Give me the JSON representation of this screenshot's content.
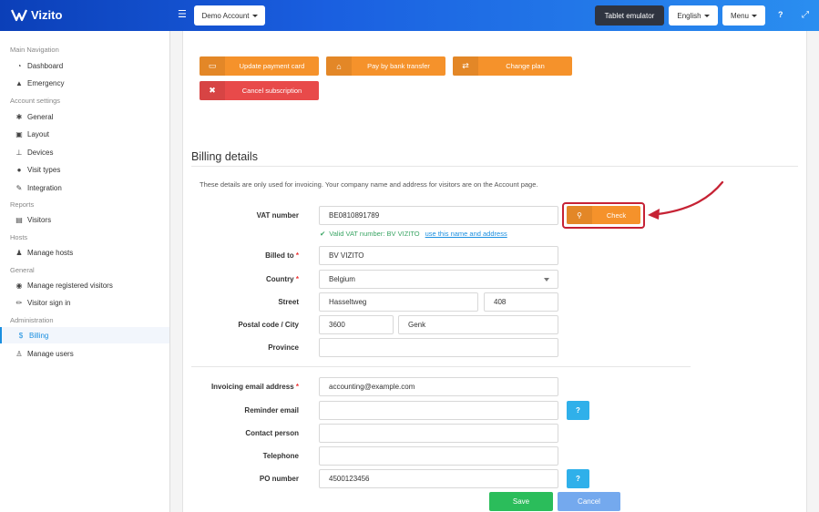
{
  "topbar": {
    "brand": "Vizito",
    "account_label": "Demo Account",
    "tablet_label": "Tablet emulator",
    "language_label": "English",
    "menu_label": "Menu",
    "help_label": "?"
  },
  "sidebar": {
    "sections": [
      {
        "title": "Main Navigation",
        "items": [
          {
            "label": "Dashboard",
            "icon": "dashboard-icon"
          },
          {
            "label": "Emergency",
            "icon": "warning-icon"
          }
        ]
      },
      {
        "title": "Account settings",
        "items": [
          {
            "label": "General",
            "icon": "gear-icon"
          },
          {
            "label": "Layout",
            "icon": "image-icon"
          },
          {
            "label": "Devices",
            "icon": "sitemap-icon"
          },
          {
            "label": "Visit types",
            "icon": "users-icon"
          },
          {
            "label": "Integration",
            "icon": "plug-icon"
          }
        ]
      },
      {
        "title": "Reports",
        "items": [
          {
            "label": "Visitors",
            "icon": "book-icon"
          }
        ]
      },
      {
        "title": "Hosts",
        "items": [
          {
            "label": "Manage hosts",
            "icon": "person-icon"
          }
        ]
      },
      {
        "title": "General",
        "items": [
          {
            "label": "Manage registered visitors",
            "icon": "globe-icon"
          },
          {
            "label": "Visitor sign in",
            "icon": "pencil-icon"
          }
        ]
      },
      {
        "title": "Administration",
        "items": [
          {
            "label": "Billing",
            "icon": "dollar-icon",
            "active": true
          },
          {
            "label": "Manage users",
            "icon": "user-plus-icon"
          }
        ]
      }
    ]
  },
  "actions": {
    "update_card": "Update payment card",
    "bank_transfer": "Pay by bank transfer",
    "change_plan": "Change plan",
    "cancel_subscription": "Cancel subscription"
  },
  "billing": {
    "title": "Billing details",
    "description": "These details are only used for invoicing. Your company name and address for visitors are on the Account page.",
    "vat_label": "VAT number",
    "vat_value": "BE0810891789",
    "check_label": "Check",
    "valid_text": "Valid VAT number: BV VIZITO",
    "use_link": "use this name and address",
    "billed_to_label": "Billed to",
    "billed_to_value": "BV VIZITO",
    "country_label": "Country",
    "country_value": "Belgium",
    "street_label": "Street",
    "street_value": "Hasseltweg",
    "number_value": "408",
    "postal_label": "Postal code / City",
    "postal_value": "3600",
    "city_value": "Genk",
    "province_label": "Province",
    "province_value": "",
    "invoice_email_label": "Invoicing email address",
    "invoice_email_value": "accounting@example.com",
    "reminder_label": "Reminder email",
    "reminder_value": "",
    "contact_label": "Contact person",
    "contact_value": "",
    "telephone_label": "Telephone",
    "telephone_value": "",
    "po_label": "PO number",
    "po_value": "4500123456",
    "required_mark": "*",
    "help_q": "?",
    "save_label": "Save",
    "cancel_label": "Cancel"
  },
  "colors": {
    "orange": "#f5922b",
    "red": "#e84a4a",
    "green": "#2bbd5b",
    "blue": "#1a8fe0",
    "highlight": "#c62234"
  }
}
